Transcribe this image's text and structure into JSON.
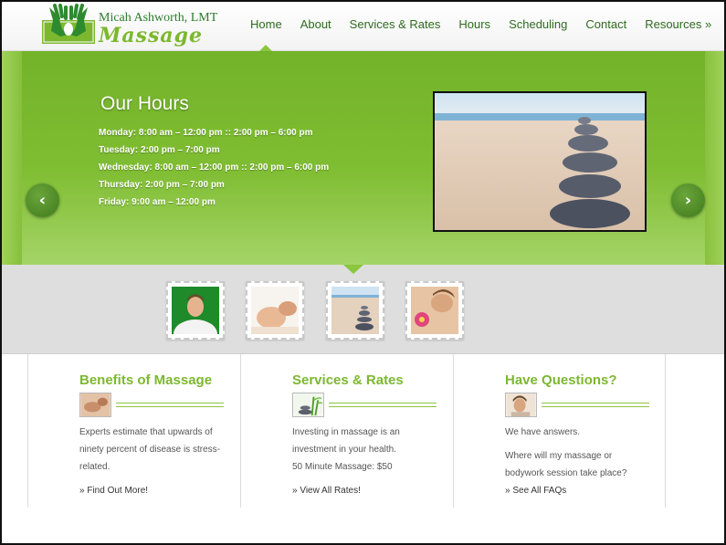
{
  "brand": {
    "name": "Micah Ashworth, LMT",
    "wordmark": "Massage",
    "colors": {
      "primary": "#7cb82f",
      "dark": "#2e6b1e"
    }
  },
  "nav": {
    "items": [
      {
        "label": "Home",
        "active": true
      },
      {
        "label": "About"
      },
      {
        "label": "Services & Rates"
      },
      {
        "label": "Hours"
      },
      {
        "label": "Scheduling"
      },
      {
        "label": "Contact"
      },
      {
        "label": "Resources »"
      }
    ]
  },
  "slider": {
    "title": "Our Hours",
    "hours": [
      "Monday: 8:00 am – 12:00 pm :: 2:00 pm – 6:00 pm",
      "Tuesday: 2:00 pm – 7:00 pm",
      "Wednesday: 8:00 am – 12:00 pm :: 2:00 pm – 6:00 pm",
      "Thursday: 2:00 pm – 7:00 pm",
      "Friday: 9:00 am – 12:00 pm"
    ],
    "image_icon": "stacked-stones-on-beach",
    "prev_icon": "‹",
    "next_icon": "›"
  },
  "thumbnails": [
    {
      "icon": "therapist-portrait"
    },
    {
      "icon": "face-massage"
    },
    {
      "icon": "stacked-stones"
    },
    {
      "icon": "back-massage-flower"
    }
  ],
  "columns": [
    {
      "title": "Benefits of Massage",
      "icon": "massage-photo-icon",
      "paragraphs": [
        "Experts estimate that upwards of ninety percent of disease is stress-related."
      ],
      "link": "» Find Out More!"
    },
    {
      "title": "Services & Rates",
      "icon": "bamboo-stones-icon",
      "paragraphs": [
        "Investing in massage is an investment in your health.",
        "50 Minute Massage: $50"
      ],
      "link": "» View All Rates!"
    },
    {
      "title": "Have Questions?",
      "icon": "client-photo-icon",
      "paragraphs": [
        "We have answers.",
        "Where will my massage or bodywork session take place?"
      ],
      "link": "» See All FAQs"
    }
  ]
}
